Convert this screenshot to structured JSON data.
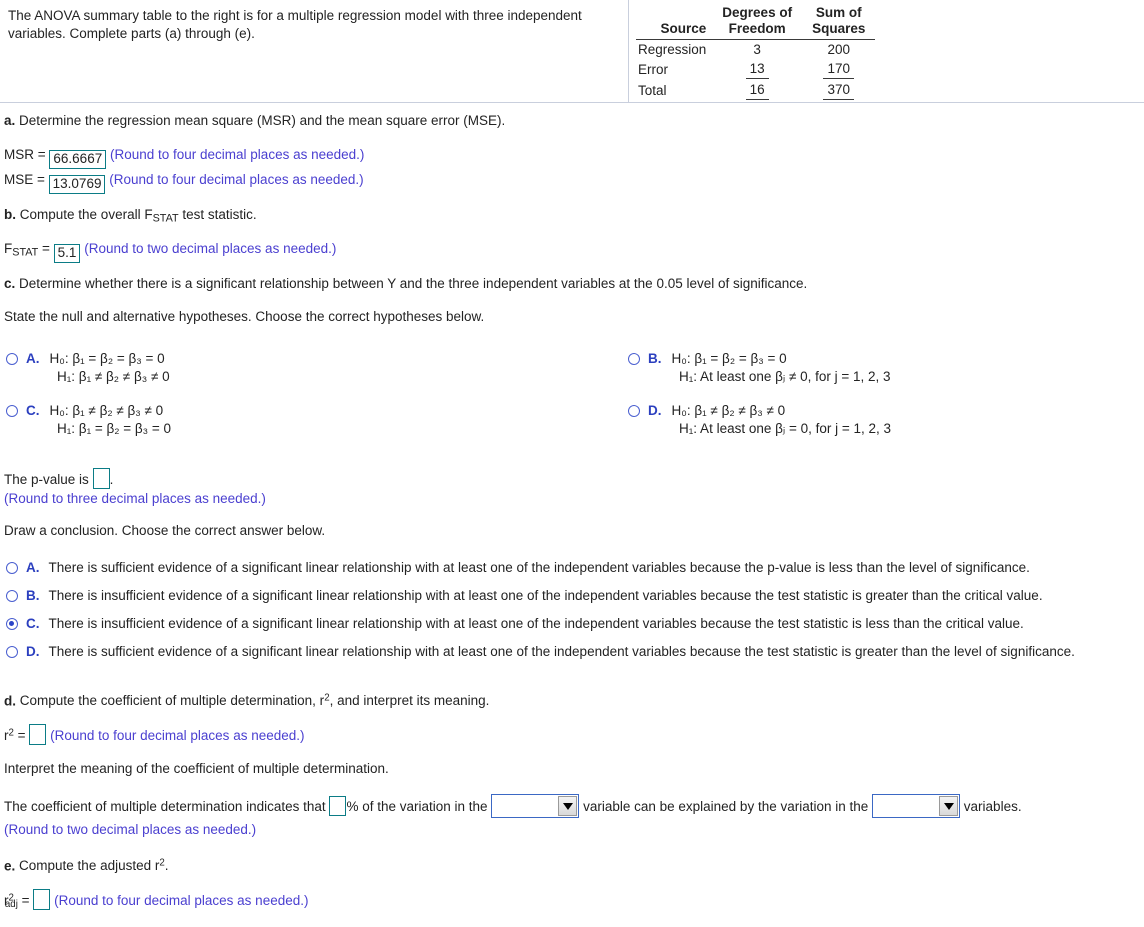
{
  "prompt": {
    "text": "The ANOVA summary table to the right is for a multiple regression model with three independent variables. Complete parts (a) through (e)."
  },
  "anova_table": {
    "headers": {
      "source": "Source",
      "df_line1": "Degrees of",
      "df_line2": "Freedom",
      "ss_line1": "Sum of",
      "ss_line2": "Squares"
    },
    "rows": [
      {
        "source": "Regression",
        "df": "3",
        "ss": "200"
      },
      {
        "source": "Error",
        "df": "13",
        "ss": "170"
      },
      {
        "source": "Total",
        "df": "16",
        "ss": "370"
      }
    ]
  },
  "part_a": {
    "question": "a. Determine the regression mean square (MSR) and the mean square error (MSE).",
    "msr_label": "MSR =",
    "msr_value": "66.6667",
    "msr_hint": "(Round to four decimal places as needed.)",
    "mse_label": "MSE =",
    "mse_value": "13.0769",
    "mse_hint": "(Round to four decimal places as needed.)"
  },
  "part_b": {
    "question_prefix": "b. Compute the overall F",
    "question_sub": "STAT",
    "question_suffix": " test statistic.",
    "answer_label": "F",
    "answer_sub": "STAT",
    "answer_eq": "=",
    "fstat_value": "5.1",
    "hint": "(Round to two decimal places as needed.)"
  },
  "part_c": {
    "question": "c. Determine whether there is a significant relationship between Y and the three independent variables at the 0.05 level of significance.",
    "instruction": "State the null and alternative hypotheses. Choose the correct hypotheses below.",
    "options": [
      {
        "letter": "A.",
        "h0": "H₀: β₁ = β₂ = β₃ = 0",
        "h1": "H₁: β₁ ≠ β₂ ≠ β₃ ≠ 0",
        "selected": false
      },
      {
        "letter": "B.",
        "h0": "H₀: β₁ = β₂ = β₃ = 0",
        "h1": "H₁: At least one βⱼ ≠ 0, for j = 1, 2, 3",
        "selected": false
      },
      {
        "letter": "C.",
        "h0": "H₀: β₁ ≠ β₂ ≠ β₃ ≠ 0",
        "h1": "H₁: β₁ = β₂ = β₃ = 0",
        "selected": false
      },
      {
        "letter": "D.",
        "h0": "H₀: β₁ ≠ β₂ ≠ β₃ ≠ 0",
        "h1": "H₁: At least one βⱼ = 0, for j = 1, 2, 3",
        "selected": false
      }
    ],
    "pvalue_label_pre": "The p-value is",
    "pvalue_value": "",
    "pvalue_label_post": ".",
    "pvalue_hint": "(Round to three decimal places as needed.)",
    "conclusion_instruction": "Draw a conclusion. Choose the correct answer below.",
    "conclusion_options": [
      {
        "letter": "A.",
        "text": "There is sufficient evidence of a significant linear relationship with at least one of the independent variables because the p-value is less than the level of significance.",
        "selected": false
      },
      {
        "letter": "B.",
        "text": "There is insufficient evidence of a significant linear relationship with at least one of the independent variables because the test statistic is greater than the critical value.",
        "selected": false
      },
      {
        "letter": "C.",
        "text": "There is insufficient evidence of a significant linear relationship with at least one of the independent variables because the test statistic is  less than the critical value.",
        "selected": true
      },
      {
        "letter": "D.",
        "text": "There is sufficient evidence of a significant linear relationship with at least one of the independent variables because the test statistic is greater than the level of significance.",
        "selected": false
      }
    ]
  },
  "part_d": {
    "question_pre": "d. Compute the coefficient of multiple determination, r",
    "question_sup": "2",
    "question_post": ", and interpret its meaning.",
    "answer_label": "r",
    "answer_sup": "2",
    "answer_eq": "=",
    "r2_value": "",
    "hint": "(Round to four decimal places as needed.)",
    "interpret_instruction": "Interpret the meaning of the coefficient of multiple determination.",
    "sentence_1": "The coefficient of multiple determination indicates that",
    "percent_value": "",
    "sentence_2": "% of the variation in the",
    "dropdown_1_value": "",
    "sentence_3": "variable can be explained by the variation in the",
    "dropdown_2_value": "",
    "sentence_4": "variables.",
    "sentence_hint": "(Round to two decimal places as needed.)"
  },
  "part_e": {
    "question_pre": "e. Compute the adjusted r",
    "question_sup": "2",
    "question_post": ".",
    "answer_label": "r",
    "answer_sup": "2",
    "answer_sub": "adj",
    "answer_eq": "=",
    "radj_value": "",
    "hint": "(Round to four decimal places as needed.)"
  },
  "colors": {
    "hint": "#4a3fd0",
    "input_border": "#0b7c86",
    "radio": "#4a5fd0",
    "option_letter": "#2b3fbf",
    "dropdown_border": "#3b68c4"
  }
}
